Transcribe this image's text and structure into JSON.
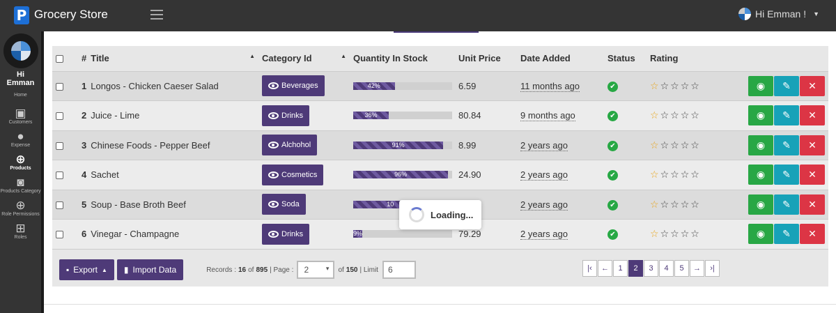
{
  "app": {
    "logo_letter": "P",
    "name": "Grocery Store",
    "user_greeting": "Hi Emman !"
  },
  "sidebar": {
    "greeting": "Hi",
    "name": "Emman",
    "items": [
      {
        "label": "Home",
        "icon": "home-icon"
      },
      {
        "label": "Customers",
        "icon": "id-card-icon"
      },
      {
        "label": "Expense",
        "icon": "user-icon"
      },
      {
        "label": "Products",
        "icon": "products-icon",
        "active": true
      },
      {
        "label": "Products Category",
        "icon": "camera-plus-icon"
      },
      {
        "label": "Role Permissions",
        "icon": "plus-circle-icon"
      },
      {
        "label": "Roles",
        "icon": "plus-square-icon"
      }
    ]
  },
  "table": {
    "columns": {
      "num": "#",
      "title": "Title",
      "category": "Category Id",
      "qty": "Quantity In Stock",
      "price": "Unit Price",
      "date": "Date Added",
      "status": "Status",
      "rating": "Rating"
    },
    "rows": [
      {
        "num": "1",
        "title": "Longos - Chicken Caeser Salad",
        "category": "Beverages",
        "qty_label": "42%",
        "qty": 0.42,
        "price": "6.59",
        "date": "11 months ago",
        "rating": 1
      },
      {
        "num": "2",
        "title": "Juice - Lime",
        "category": "Drinks",
        "qty_label": "36%",
        "qty": 0.36,
        "price": "80.84",
        "date": "9 months ago",
        "rating": 1
      },
      {
        "num": "3",
        "title": "Chinese Foods - Pepper Beef",
        "category": "Alchohol",
        "qty_label": "91%",
        "qty": 0.91,
        "price": "8.99",
        "date": "2 years ago",
        "rating": 1
      },
      {
        "num": "4",
        "title": "Sachet",
        "category": "Cosmetics",
        "qty_label": "96%",
        "qty": 0.96,
        "price": "24.90",
        "date": "2 years ago",
        "rating": 1
      },
      {
        "num": "5",
        "title": "Soup - Base Broth Beef",
        "category": "Soda",
        "qty_label": "10",
        "qty": 0.75,
        "price": "",
        "date": "2 years ago",
        "rating": 1
      },
      {
        "num": "6",
        "title": "Vinegar - Champagne",
        "category": "Drinks",
        "qty_label": "9%",
        "qty": 0.09,
        "price": "79.29",
        "date": "2 years ago",
        "rating": 1
      }
    ]
  },
  "footer": {
    "export": "Export",
    "import": "Import Data",
    "records_prefix": "Records :",
    "records_shown": "16",
    "of_word": "of",
    "records_total": "895",
    "page_label": "| Page :",
    "page_value": "2",
    "of_pages_prefix": "of",
    "pages_total": "150",
    "limit_label": "| Limit",
    "limit_value": "6"
  },
  "pager": {
    "first": "|‹",
    "prev": "←",
    "pages": [
      "1",
      "2",
      "3",
      "4",
      "5"
    ],
    "current": "2",
    "next": "→",
    "last": "›|"
  },
  "loading": {
    "text": "Loading..."
  },
  "colors": {
    "primary": "#4e3a78",
    "view": "#28a745",
    "edit": "#17a2b8",
    "delete": "#dc3545",
    "topbar": "#343434"
  }
}
